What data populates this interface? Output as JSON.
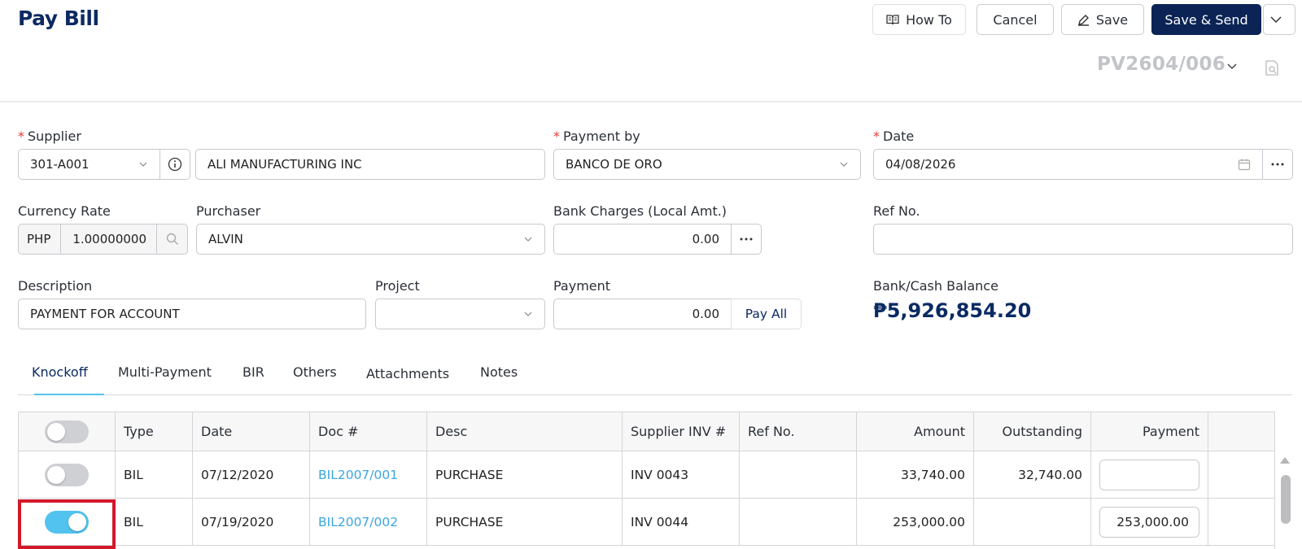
{
  "header": {
    "title": "Pay Bill",
    "how_to": "How To",
    "cancel": "Cancel",
    "save": "Save",
    "save_send": "Save & Send",
    "doc_no": "PV2604/006"
  },
  "form": {
    "supplier": {
      "label": "Supplier",
      "code": "301-A001",
      "name": "ALI MANUFACTURING INC"
    },
    "payment_by": {
      "label": "Payment by",
      "value": "BANCO DE ORO"
    },
    "date": {
      "label": "Date",
      "value": "04/08/2026"
    },
    "currency_rate": {
      "label": "Currency Rate",
      "currency": "PHP",
      "rate": "1.00000000"
    },
    "purchaser": {
      "label": "Purchaser",
      "value": "ALVIN"
    },
    "bank_charges": {
      "label": "Bank Charges (Local Amt.)",
      "value": "0.00"
    },
    "ref_no": {
      "label": "Ref No.",
      "value": ""
    },
    "description": {
      "label": "Description",
      "value": "PAYMENT FOR ACCOUNT"
    },
    "project": {
      "label": "Project",
      "value": ""
    },
    "payment": {
      "label": "Payment",
      "value": "0.00",
      "pay_all": "Pay All"
    },
    "bank_cash_balance": {
      "label": "Bank/Cash Balance",
      "value": "₱5,926,854.20"
    }
  },
  "tabs": [
    "Knockoff",
    "Multi-Payment",
    "BIR",
    "Others",
    "Attachments",
    "Notes"
  ],
  "table": {
    "columns": [
      "Type",
      "Date",
      "Doc #",
      "Desc",
      "Supplier INV #",
      "Ref No.",
      "Amount",
      "Outstanding",
      "Payment"
    ],
    "rows": [
      {
        "selected": false,
        "type": "BIL",
        "date": "07/12/2020",
        "doc": "BIL2007/001",
        "desc": "PURCHASE",
        "supplier_inv": "INV 0043",
        "ref_no": "",
        "amount": "33,740.00",
        "outstanding": "32,740.00",
        "payment": ""
      },
      {
        "selected": true,
        "type": "BIL",
        "date": "07/19/2020",
        "doc": "BIL2007/002",
        "desc": "PURCHASE",
        "supplier_inv": "INV 0044",
        "ref_no": "",
        "amount": "253,000.00",
        "outstanding": "",
        "payment": "253,000.00"
      }
    ]
  },
  "colors": {
    "brand": "#0b2455",
    "accent": "#52c3ef",
    "link": "#3aa6e0",
    "required": "#e53935",
    "highlight": "#d3182a"
  },
  "icons": [
    "book-icon",
    "pencil-icon",
    "chevron-down-icon",
    "document-search-icon",
    "info-icon",
    "calendar-icon",
    "ellipsis-icon",
    "search-icon"
  ]
}
